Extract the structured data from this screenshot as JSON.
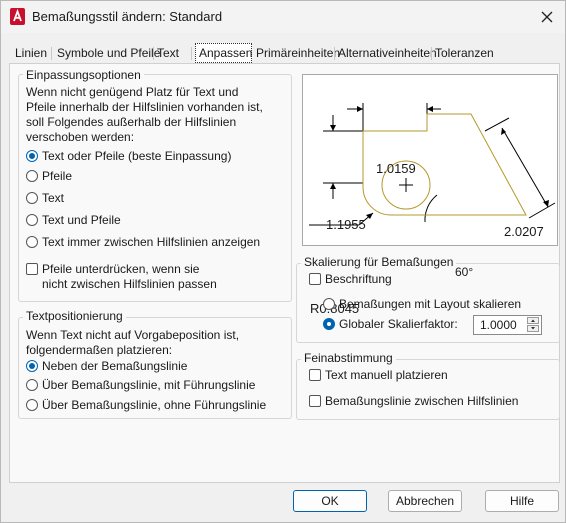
{
  "window": {
    "title": "Bemaßungsstil ändern: Standard"
  },
  "tabs": [
    {
      "label": "Linien"
    },
    {
      "label": "Symbole und Pfeile"
    },
    {
      "label": "Text"
    },
    {
      "label": "Anpassen"
    },
    {
      "label": "Primäreinheiten"
    },
    {
      "label": "Alternativeinheiten"
    },
    {
      "label": "Toleranzen"
    }
  ],
  "fit_options": {
    "legend": "Einpassungsoptionen",
    "description": [
      "Wenn nicht genügend Platz für Text und",
      "Pfeile innerhalb der Hilfslinien vorhanden ist,",
      "soll Folgendes außerhalb der Hilfslinien",
      "verschoben werden:"
    ],
    "options": [
      {
        "label": "Text oder Pfeile (beste Einpassung)",
        "selected": true
      },
      {
        "label": "Pfeile",
        "selected": false
      },
      {
        "label": "Text",
        "selected": false
      },
      {
        "label": "Text und Pfeile",
        "selected": false
      },
      {
        "label": "Text immer zwischen Hilfslinien anzeigen",
        "selected": false
      }
    ],
    "suppress_arrows": {
      "line1": "Pfeile unterdrücken, wenn sie",
      "line2": "nicht zwischen Hilfslinien passen",
      "checked": false
    }
  },
  "text_placement": {
    "legend": "Textpositionierung",
    "description": [
      "Wenn Text nicht auf Vorgabeposition ist,",
      "folgendermaßen platzieren:"
    ],
    "options": [
      {
        "label": "Neben der Bemaßungslinie",
        "selected": true
      },
      {
        "label": "Über Bemaßungslinie, mit Führungslinie",
        "selected": false
      },
      {
        "label": "Über Bemaßungslinie, ohne Führungslinie",
        "selected": false
      }
    ]
  },
  "preview": {
    "dim_top": "1.0159",
    "dim_left": "1.1955",
    "dim_right": "2.0207",
    "angle": "60°",
    "radius": "R0.8045"
  },
  "scale": {
    "legend": "Skalierung für Bemaßungen",
    "annotative": {
      "label": "Beschriftung",
      "checked": false
    },
    "layout_option": {
      "label": "Bemaßungen mit Layout skalieren",
      "selected": false
    },
    "global_option": {
      "label": "Globaler Skalierfaktor:",
      "selected": true
    },
    "global_value": "1.0000"
  },
  "fine_tuning": {
    "legend": "Feinabstimmung",
    "manual_text": {
      "label": "Text manuell platzieren",
      "checked": false
    },
    "draw_line": {
      "label": "Bemaßungslinie zwischen Hilfslinien",
      "checked": false
    }
  },
  "buttons": {
    "ok": "OK",
    "cancel": "Abbrechen",
    "help": "Hilfe"
  },
  "colors": {
    "accent": "#0063b1",
    "app_icon": "#c8102e",
    "preview_line": "#b59a2a"
  }
}
